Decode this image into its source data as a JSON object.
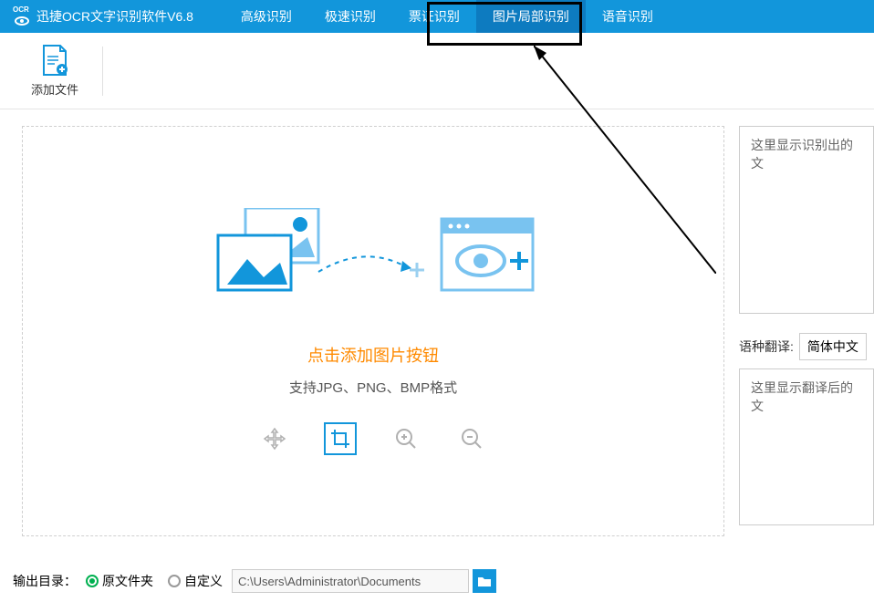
{
  "app": {
    "title": "迅捷OCR文字识别软件V6.8"
  },
  "nav": {
    "tabs": [
      {
        "label": "高级识别",
        "active": false
      },
      {
        "label": "极速识别",
        "active": false
      },
      {
        "label": "票证识别",
        "active": false
      },
      {
        "label": "图片局部识别",
        "active": true
      },
      {
        "label": "语音识别",
        "active": false
      }
    ]
  },
  "toolbar": {
    "add_file_label": "添加文件"
  },
  "dropzone": {
    "prompt": "点击添加图片按钮",
    "formats": "支持JPG、PNG、BMP格式"
  },
  "right": {
    "result_placeholder": "这里显示识别出的文",
    "translate_label": "语种翻译:",
    "translate_value": "简体中文",
    "translate_placeholder": "这里显示翻译后的文"
  },
  "output": {
    "label": "输出目录：",
    "option_original": "原文件夹",
    "option_custom": "自定义",
    "path": "C:\\Users\\Administrator\\Documents"
  }
}
